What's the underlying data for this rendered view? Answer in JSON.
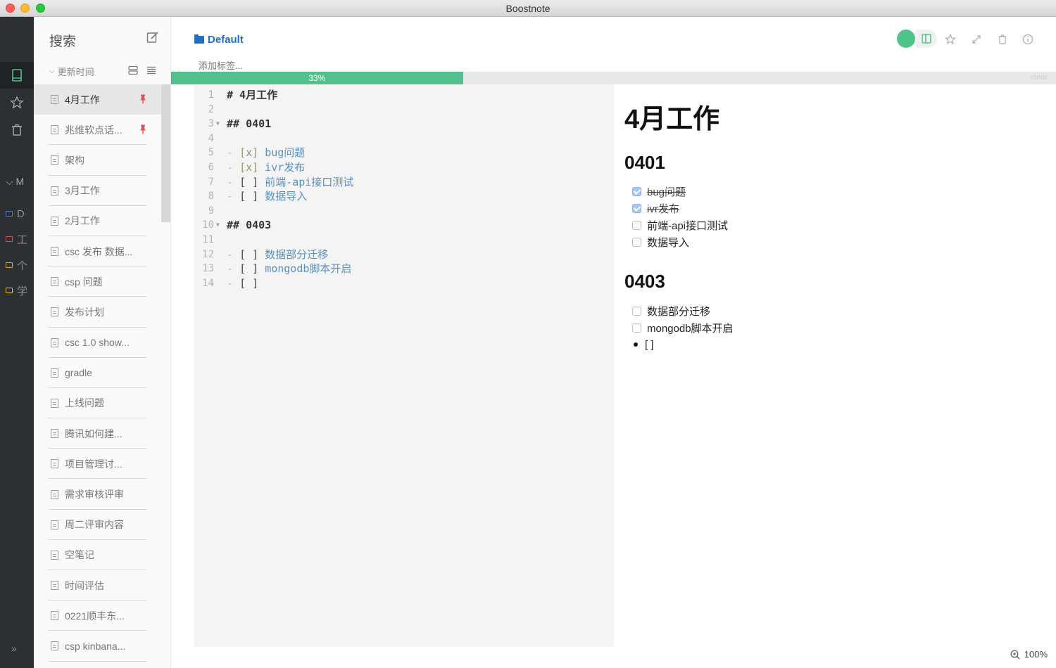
{
  "window": {
    "title": "Boostnote"
  },
  "rail": {
    "items": [
      {
        "icon": "notebook-icon",
        "active": true
      },
      {
        "icon": "star-icon",
        "active": false
      },
      {
        "icon": "trash-icon",
        "active": false
      }
    ],
    "storage_label": "M",
    "folders": [
      {
        "name": "D",
        "color": "#3d7cc9"
      },
      {
        "name": "工",
        "color": "#d9534f"
      },
      {
        "name": "个",
        "color": "#e8a33d"
      },
      {
        "name": "学",
        "color": "#e2c13b"
      }
    ],
    "expand_label": "»"
  },
  "notelist": {
    "search_label": "搜索",
    "sort_label": "更新时间",
    "notes": [
      {
        "title": "4月工作",
        "pinned": true,
        "active": true
      },
      {
        "title": "兆维软点话...",
        "pinned": true,
        "active": false
      },
      {
        "title": "架构",
        "pinned": false,
        "active": false
      },
      {
        "title": "3月工作",
        "pinned": false,
        "active": false
      },
      {
        "title": "2月工作",
        "pinned": false,
        "active": false
      },
      {
        "title": "csc 发布 数据...",
        "pinned": false,
        "active": false
      },
      {
        "title": "csp 问题",
        "pinned": false,
        "active": false
      },
      {
        "title": "发布计划",
        "pinned": false,
        "active": false
      },
      {
        "title": "csc 1.0 show...",
        "pinned": false,
        "active": false
      },
      {
        "title": "gradle",
        "pinned": false,
        "active": false
      },
      {
        "title": "上线问题",
        "pinned": false,
        "active": false
      },
      {
        "title": "腾讯如何建...",
        "pinned": false,
        "active": false
      },
      {
        "title": "项目管理讨...",
        "pinned": false,
        "active": false
      },
      {
        "title": "需求审核评审",
        "pinned": false,
        "active": false
      },
      {
        "title": "周二评审内容",
        "pinned": false,
        "active": false
      },
      {
        "title": "空笔记",
        "pinned": false,
        "active": false
      },
      {
        "title": "时间评估",
        "pinned": false,
        "active": false
      },
      {
        "title": "0221顺丰东...",
        "pinned": false,
        "active": false
      },
      {
        "title": "csp kinbana...",
        "pinned": false,
        "active": false
      }
    ]
  },
  "header": {
    "folder": "Default",
    "tag_placeholder": "添加标签...",
    "progress_percent": 33,
    "progress_label": "33%",
    "progress_clear": "clear"
  },
  "editor": {
    "lines": [
      {
        "n": "1",
        "type": "h",
        "text": "# 4月工作"
      },
      {
        "n": "2",
        "type": "blank",
        "text": ""
      },
      {
        "n": "3",
        "type": "h",
        "text": "## 0401",
        "fold": true
      },
      {
        "n": "4",
        "type": "blank",
        "text": ""
      },
      {
        "n": "5",
        "type": "task",
        "mark": "[x]",
        "text": "bug问题"
      },
      {
        "n": "6",
        "type": "task",
        "mark": "[x]",
        "text": "ivr发布"
      },
      {
        "n": "7",
        "type": "task",
        "mark": "[ ]",
        "text": "前端-api接口测试"
      },
      {
        "n": "8",
        "type": "task",
        "mark": "[ ]",
        "text": "数据导入"
      },
      {
        "n": "9",
        "type": "blank",
        "text": ""
      },
      {
        "n": "10",
        "type": "h",
        "text": "## 0403",
        "fold": true
      },
      {
        "n": "11",
        "type": "blank",
        "text": ""
      },
      {
        "n": "12",
        "type": "task",
        "mark": "[ ]",
        "text": "数据部分迁移"
      },
      {
        "n": "13",
        "type": "task",
        "mark": "[ ]",
        "text": "mongodb脚本开启"
      },
      {
        "n": "14",
        "type": "task",
        "mark": "[ ]",
        "text": ""
      }
    ]
  },
  "preview": {
    "h1": "4月工作",
    "sections": [
      {
        "h2": "0401",
        "tasks": [
          {
            "text": "bug问题",
            "checked": true
          },
          {
            "text": "ivr发布",
            "checked": true
          },
          {
            "text": "前端-api接口测试",
            "checked": false
          },
          {
            "text": "数据导入",
            "checked": false
          }
        ]
      },
      {
        "h2": "0403",
        "tasks": [
          {
            "text": "数据部分迁移",
            "checked": false
          },
          {
            "text": "mongodb脚本开启",
            "checked": false
          }
        ],
        "bullet": "[ ]"
      }
    ]
  },
  "zoom": {
    "label": "100%"
  },
  "colors": {
    "accent": "#52c08a",
    "folder_blue": "#1f6fc5",
    "rail": "#2c3033"
  }
}
